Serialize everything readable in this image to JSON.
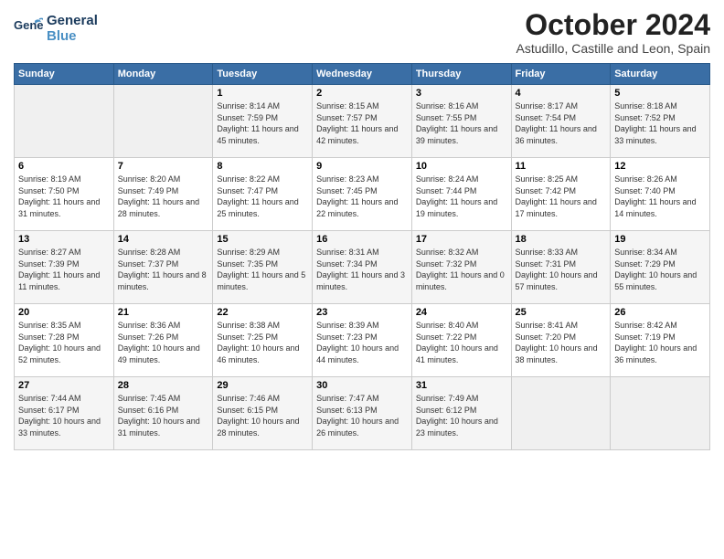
{
  "logo": {
    "line1": "General",
    "line2": "Blue",
    "bird_color": "#4a90c4"
  },
  "header": {
    "month": "October 2024",
    "location": "Astudillo, Castille and Leon, Spain"
  },
  "weekdays": [
    "Sunday",
    "Monday",
    "Tuesday",
    "Wednesday",
    "Thursday",
    "Friday",
    "Saturday"
  ],
  "weeks": [
    [
      {
        "day": "",
        "info": ""
      },
      {
        "day": "",
        "info": ""
      },
      {
        "day": "1",
        "info": "Sunrise: 8:14 AM\nSunset: 7:59 PM\nDaylight: 11 hours and 45 minutes."
      },
      {
        "day": "2",
        "info": "Sunrise: 8:15 AM\nSunset: 7:57 PM\nDaylight: 11 hours and 42 minutes."
      },
      {
        "day": "3",
        "info": "Sunrise: 8:16 AM\nSunset: 7:55 PM\nDaylight: 11 hours and 39 minutes."
      },
      {
        "day": "4",
        "info": "Sunrise: 8:17 AM\nSunset: 7:54 PM\nDaylight: 11 hours and 36 minutes."
      },
      {
        "day": "5",
        "info": "Sunrise: 8:18 AM\nSunset: 7:52 PM\nDaylight: 11 hours and 33 minutes."
      }
    ],
    [
      {
        "day": "6",
        "info": "Sunrise: 8:19 AM\nSunset: 7:50 PM\nDaylight: 11 hours and 31 minutes."
      },
      {
        "day": "7",
        "info": "Sunrise: 8:20 AM\nSunset: 7:49 PM\nDaylight: 11 hours and 28 minutes."
      },
      {
        "day": "8",
        "info": "Sunrise: 8:22 AM\nSunset: 7:47 PM\nDaylight: 11 hours and 25 minutes."
      },
      {
        "day": "9",
        "info": "Sunrise: 8:23 AM\nSunset: 7:45 PM\nDaylight: 11 hours and 22 minutes."
      },
      {
        "day": "10",
        "info": "Sunrise: 8:24 AM\nSunset: 7:44 PM\nDaylight: 11 hours and 19 minutes."
      },
      {
        "day": "11",
        "info": "Sunrise: 8:25 AM\nSunset: 7:42 PM\nDaylight: 11 hours and 17 minutes."
      },
      {
        "day": "12",
        "info": "Sunrise: 8:26 AM\nSunset: 7:40 PM\nDaylight: 11 hours and 14 minutes."
      }
    ],
    [
      {
        "day": "13",
        "info": "Sunrise: 8:27 AM\nSunset: 7:39 PM\nDaylight: 11 hours and 11 minutes."
      },
      {
        "day": "14",
        "info": "Sunrise: 8:28 AM\nSunset: 7:37 PM\nDaylight: 11 hours and 8 minutes."
      },
      {
        "day": "15",
        "info": "Sunrise: 8:29 AM\nSunset: 7:35 PM\nDaylight: 11 hours and 5 minutes."
      },
      {
        "day": "16",
        "info": "Sunrise: 8:31 AM\nSunset: 7:34 PM\nDaylight: 11 hours and 3 minutes."
      },
      {
        "day": "17",
        "info": "Sunrise: 8:32 AM\nSunset: 7:32 PM\nDaylight: 11 hours and 0 minutes."
      },
      {
        "day": "18",
        "info": "Sunrise: 8:33 AM\nSunset: 7:31 PM\nDaylight: 10 hours and 57 minutes."
      },
      {
        "day": "19",
        "info": "Sunrise: 8:34 AM\nSunset: 7:29 PM\nDaylight: 10 hours and 55 minutes."
      }
    ],
    [
      {
        "day": "20",
        "info": "Sunrise: 8:35 AM\nSunset: 7:28 PM\nDaylight: 10 hours and 52 minutes."
      },
      {
        "day": "21",
        "info": "Sunrise: 8:36 AM\nSunset: 7:26 PM\nDaylight: 10 hours and 49 minutes."
      },
      {
        "day": "22",
        "info": "Sunrise: 8:38 AM\nSunset: 7:25 PM\nDaylight: 10 hours and 46 minutes."
      },
      {
        "day": "23",
        "info": "Sunrise: 8:39 AM\nSunset: 7:23 PM\nDaylight: 10 hours and 44 minutes."
      },
      {
        "day": "24",
        "info": "Sunrise: 8:40 AM\nSunset: 7:22 PM\nDaylight: 10 hours and 41 minutes."
      },
      {
        "day": "25",
        "info": "Sunrise: 8:41 AM\nSunset: 7:20 PM\nDaylight: 10 hours and 38 minutes."
      },
      {
        "day": "26",
        "info": "Sunrise: 8:42 AM\nSunset: 7:19 PM\nDaylight: 10 hours and 36 minutes."
      }
    ],
    [
      {
        "day": "27",
        "info": "Sunrise: 7:44 AM\nSunset: 6:17 PM\nDaylight: 10 hours and 33 minutes."
      },
      {
        "day": "28",
        "info": "Sunrise: 7:45 AM\nSunset: 6:16 PM\nDaylight: 10 hours and 31 minutes."
      },
      {
        "day": "29",
        "info": "Sunrise: 7:46 AM\nSunset: 6:15 PM\nDaylight: 10 hours and 28 minutes."
      },
      {
        "day": "30",
        "info": "Sunrise: 7:47 AM\nSunset: 6:13 PM\nDaylight: 10 hours and 26 minutes."
      },
      {
        "day": "31",
        "info": "Sunrise: 7:49 AM\nSunset: 6:12 PM\nDaylight: 10 hours and 23 minutes."
      },
      {
        "day": "",
        "info": ""
      },
      {
        "day": "",
        "info": ""
      }
    ]
  ]
}
